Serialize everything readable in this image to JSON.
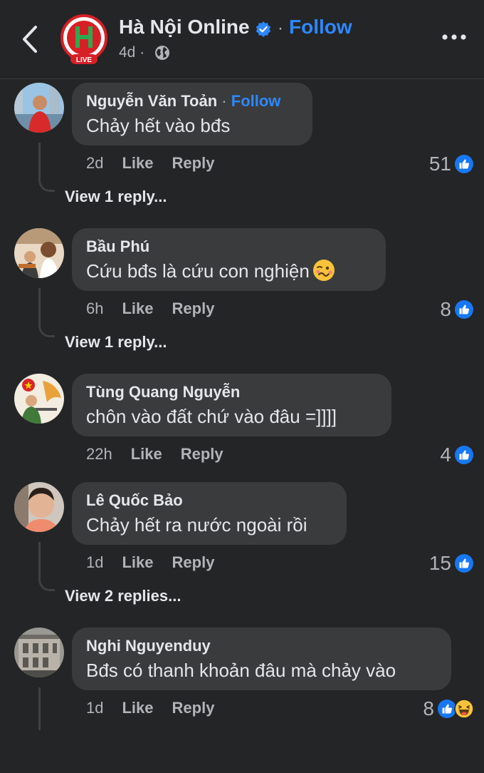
{
  "header": {
    "page_name": "Hà Nội Online",
    "separator": "·",
    "follow_label": "Follow",
    "time": "4d ·",
    "page_badge": "LIVE"
  },
  "comments": [
    {
      "author": "Nguyễn Văn Toản",
      "separator": "·",
      "follow_label": "Follow",
      "text": "Chảy hết vào bđs",
      "time": "2d",
      "like": "Like",
      "reply": "Reply",
      "reaction_count": "51",
      "reactions": [
        "like-icon"
      ],
      "view_replies": "View 1 reply..."
    },
    {
      "author": "Bầu Phú",
      "text": "Cứu bđs là cứu con nghiện",
      "emoji": "woozy-face-emoji",
      "time": "6h",
      "like": "Like",
      "reply": "Reply",
      "reaction_count": "8",
      "reactions": [
        "like-icon"
      ],
      "view_replies": "View 1 reply..."
    },
    {
      "author": "Tùng Quang Nguyễn",
      "text": "chôn vào đất chứ vào đâu =]]]]",
      "time": "22h",
      "like": "Like",
      "reply": "Reply",
      "reaction_count": "4",
      "reactions": [
        "like-icon"
      ]
    },
    {
      "author": "Lê Quốc Bảo",
      "text": "Chảy hết ra nước ngoài rồi",
      "time": "1d",
      "like": "Like",
      "reply": "Reply",
      "reaction_count": "15",
      "reactions": [
        "like-icon"
      ],
      "view_replies": "View 2 replies..."
    },
    {
      "author": "Nghi Nguyenduy",
      "text": "Bđs có thanh khoản đâu mà chảy vào",
      "time": "1d",
      "like": "Like",
      "reply": "Reply",
      "reaction_count": "8",
      "reactions": [
        "like-icon",
        "laughing-face-icon"
      ]
    }
  ],
  "colors": {
    "background": "#242526",
    "bubble": "#3a3b3c",
    "accent": "#2d88ff",
    "secondary_text": "#b0b3b8"
  }
}
